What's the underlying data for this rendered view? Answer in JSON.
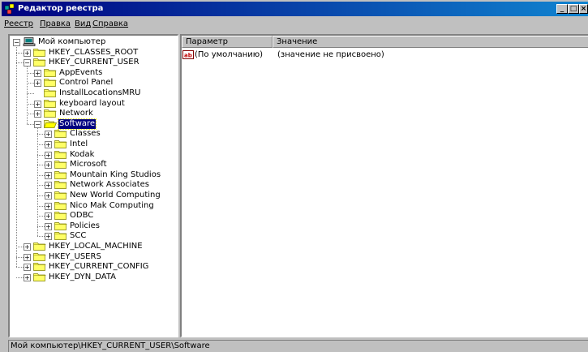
{
  "window": {
    "title": "Редактор реестра"
  },
  "menu": [
    {
      "label": "Реестр"
    },
    {
      "label": "Правка"
    },
    {
      "label": "Вид"
    },
    {
      "label": "Справка"
    }
  ],
  "tree": {
    "nodes": [
      {
        "label": "Мой компьютер",
        "expander": "−",
        "icon": "computer-icon"
      },
      {
        "label": "HKEY_CLASSES_ROOT",
        "expander": "+",
        "icon": "folder-icon"
      },
      {
        "label": "HKEY_CURRENT_USER",
        "expander": "−",
        "icon": "folder-icon"
      },
      {
        "label": "AppEvents",
        "expander": "+",
        "icon": "folder-icon"
      },
      {
        "label": "Control Panel",
        "expander": "+",
        "icon": "folder-icon"
      },
      {
        "label": "InstallLocationsMRU",
        "expander": "",
        "icon": "folder-icon"
      },
      {
        "label": "keyboard layout",
        "expander": "+",
        "icon": "folder-icon"
      },
      {
        "label": "Network",
        "expander": "+",
        "icon": "folder-icon"
      },
      {
        "label": "Software",
        "expander": "−",
        "icon": "open-folder-icon",
        "selected": true
      },
      {
        "label": "Classes",
        "expander": "+",
        "icon": "folder-icon"
      },
      {
        "label": "Intel",
        "expander": "+",
        "icon": "folder-icon"
      },
      {
        "label": "Kodak",
        "expander": "+",
        "icon": "folder-icon"
      },
      {
        "label": "Microsoft",
        "expander": "+",
        "icon": "folder-icon"
      },
      {
        "label": "Mountain King Studios",
        "expander": "+",
        "icon": "folder-icon"
      },
      {
        "label": "Network Associates",
        "expander": "+",
        "icon": "folder-icon"
      },
      {
        "label": "New World Computing",
        "expander": "+",
        "icon": "folder-icon"
      },
      {
        "label": "Nico Mak Computing",
        "expander": "+",
        "icon": "folder-icon"
      },
      {
        "label": "ODBC",
        "expander": "+",
        "icon": "folder-icon"
      },
      {
        "label": "Policies",
        "expander": "+",
        "icon": "folder-icon"
      },
      {
        "label": "SCC",
        "expander": "+",
        "icon": "folder-icon"
      },
      {
        "label": "HKEY_LOCAL_MACHINE",
        "expander": "+",
        "icon": "folder-icon"
      },
      {
        "label": "HKEY_USERS",
        "expander": "+",
        "icon": "folder-icon"
      },
      {
        "label": "HKEY_CURRENT_CONFIG",
        "expander": "+",
        "icon": "folder-icon"
      },
      {
        "label": "HKEY_DYN_DATA",
        "expander": "+",
        "icon": "folder-icon"
      }
    ]
  },
  "list": {
    "columns": [
      "Параметр",
      "Значение"
    ],
    "rows": [
      {
        "name": "(По умолчанию)",
        "value": "(значение не присвоено)",
        "icon": "string-value-icon"
      }
    ]
  },
  "status": {
    "path": "Мой компьютер\\HKEY_CURRENT_USER\\Software"
  },
  "colors": {
    "titlebar_start": "#000080",
    "titlebar_end": "#1084d0",
    "selection": "#000080"
  }
}
